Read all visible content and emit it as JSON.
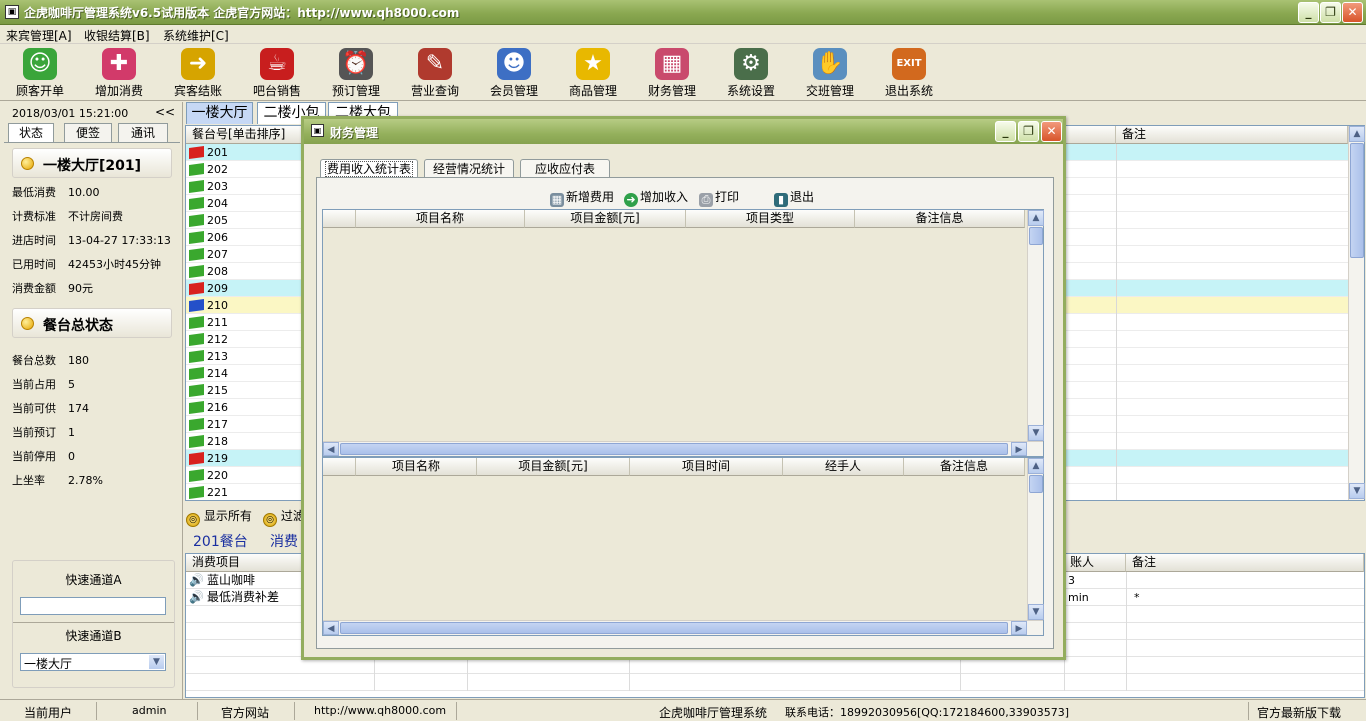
{
  "window": {
    "title": "企虎咖啡厅管理系统v6.5试用版本   企虎官方网站：http://www.qh8000.com",
    "min": "_",
    "max": "❐",
    "close": "✕"
  },
  "menu": [
    "来宾管理[A]",
    "收银结算[B]",
    "系统维护[C]"
  ],
  "toolbar": [
    {
      "label": "顾客开单",
      "icon": "person-icon",
      "glyph": "☺",
      "color": "#3aa53a"
    },
    {
      "label": "增加消费",
      "icon": "add-icon",
      "glyph": "✚",
      "color": "#d23a6a"
    },
    {
      "label": "宾客结账",
      "icon": "arrow-icon",
      "glyph": "➜",
      "color": "#d6a400"
    },
    {
      "label": "吧台销售",
      "icon": "cup-icon",
      "glyph": "☕",
      "color": "#c81e1e"
    },
    {
      "label": "预订管理",
      "icon": "clock-icon",
      "glyph": "⏰",
      "color": "#555555"
    },
    {
      "label": "营业查询",
      "icon": "report-icon",
      "glyph": "✎",
      "color": "#b03a2e"
    },
    {
      "label": "会员管理",
      "icon": "members-icon",
      "glyph": "☻",
      "color": "#3d6fc4"
    },
    {
      "label": "商品管理",
      "icon": "star-icon",
      "glyph": "★",
      "color": "#e8b800"
    },
    {
      "label": "财务管理",
      "icon": "calculator-icon",
      "glyph": "▦",
      "color": "#c94a6c"
    },
    {
      "label": "系统设置",
      "icon": "settings-icon",
      "glyph": "⚙",
      "color": "#4a6e4a"
    },
    {
      "label": "交班管理",
      "icon": "handshake-icon",
      "glyph": "✋",
      "color": "#5a8fbf"
    },
    {
      "label": "退出系统",
      "icon": "exit-icon",
      "glyph": "EXIT",
      "color": "#d2691e"
    }
  ],
  "left": {
    "datetime": "2018/03/01 15:21:00",
    "collapse": "<<",
    "tabs": [
      "状态",
      "便签",
      "通讯"
    ],
    "table_header": "一楼大厅[201]",
    "table_info": [
      {
        "k": "最低消费",
        "v": "10.00"
      },
      {
        "k": "计费标准",
        "v": "不计房间费"
      },
      {
        "k": "进店时间",
        "v": "13-04-27 17:33:13"
      },
      {
        "k": "已用时间",
        "v": "42453小时45分钟"
      },
      {
        "k": "消费金额",
        "v": "90元"
      }
    ],
    "summary_header": "餐台总状态",
    "summary": [
      {
        "k": "餐台总数",
        "v": "180"
      },
      {
        "k": "当前占用",
        "v": "5"
      },
      {
        "k": "当前可供",
        "v": "174"
      },
      {
        "k": "当前预订",
        "v": "1"
      },
      {
        "k": "当前停用",
        "v": "0"
      },
      {
        "k": "上坐率",
        "v": "2.78%"
      }
    ],
    "quickA": "快速通道A",
    "quickB": "快速通道B",
    "quickB_value": "一楼大厅"
  },
  "floor_tabs": [
    "一楼大厅",
    "二楼小包",
    "二楼大包"
  ],
  "tables": {
    "col_table": "餐台号[单击排序]",
    "col_note": "备注",
    "rows": [
      {
        "no": "201",
        "flag": "red",
        "hl": "cyan"
      },
      {
        "no": "202",
        "flag": "green",
        "hl": ""
      },
      {
        "no": "203",
        "flag": "green",
        "hl": ""
      },
      {
        "no": "204",
        "flag": "green",
        "hl": ""
      },
      {
        "no": "205",
        "flag": "green",
        "hl": ""
      },
      {
        "no": "206",
        "flag": "green",
        "hl": ""
      },
      {
        "no": "207",
        "flag": "green",
        "hl": ""
      },
      {
        "no": "208",
        "flag": "green",
        "hl": ""
      },
      {
        "no": "209",
        "flag": "red",
        "hl": "cyan"
      },
      {
        "no": "210",
        "flag": "blue",
        "hl": "yellow"
      },
      {
        "no": "211",
        "flag": "green",
        "hl": ""
      },
      {
        "no": "212",
        "flag": "green",
        "hl": ""
      },
      {
        "no": "213",
        "flag": "green",
        "hl": ""
      },
      {
        "no": "214",
        "flag": "green",
        "hl": ""
      },
      {
        "no": "215",
        "flag": "green",
        "hl": ""
      },
      {
        "no": "216",
        "flag": "green",
        "hl": ""
      },
      {
        "no": "217",
        "flag": "green",
        "hl": ""
      },
      {
        "no": "218",
        "flag": "green",
        "hl": ""
      },
      {
        "no": "219",
        "flag": "red",
        "hl": "cyan"
      },
      {
        "no": "220",
        "flag": "green",
        "hl": ""
      },
      {
        "no": "221",
        "flag": "green",
        "hl": ""
      }
    ]
  },
  "filters": {
    "show_all": "显示所有",
    "filter": "过滤"
  },
  "consume": {
    "table_label": "201餐台",
    "tab2": "消费",
    "col_item": "消费项目",
    "col_handler": "账人",
    "col_note": "备注",
    "rows": [
      {
        "item": "蓝山咖啡",
        "handler": "3",
        "note": ""
      },
      {
        "item": "最低消费补差",
        "handler": "min",
        "note": "*"
      }
    ]
  },
  "status": {
    "user_label": "当前用户",
    "user": "admin",
    "site_label": "官方网站",
    "site": "http://www.qh8000.com",
    "app": "企虎咖啡厅管理系统",
    "phone": "联系电话：18992030956[QQ:172184600,33903573]",
    "download": "官方最新版下载"
  },
  "dialog": {
    "title": "财务管理",
    "tabs": [
      "费用收入统计表",
      "经营情况统计",
      "应收应付表"
    ],
    "buttons": [
      {
        "label": "新增费用",
        "icon": "calculator-icon"
      },
      {
        "label": "增加收入",
        "icon": "arrow-icon"
      },
      {
        "label": "打印",
        "icon": "printer-icon"
      },
      {
        "label": "退出",
        "icon": "exit-icon"
      }
    ],
    "upper_cols": [
      "项目名称",
      "项目金额[元]",
      "项目类型",
      "备注信息"
    ],
    "lower_cols": [
      "项目名称",
      "项目金额[元]",
      "项目时间",
      "经手人",
      "备注信息"
    ]
  }
}
